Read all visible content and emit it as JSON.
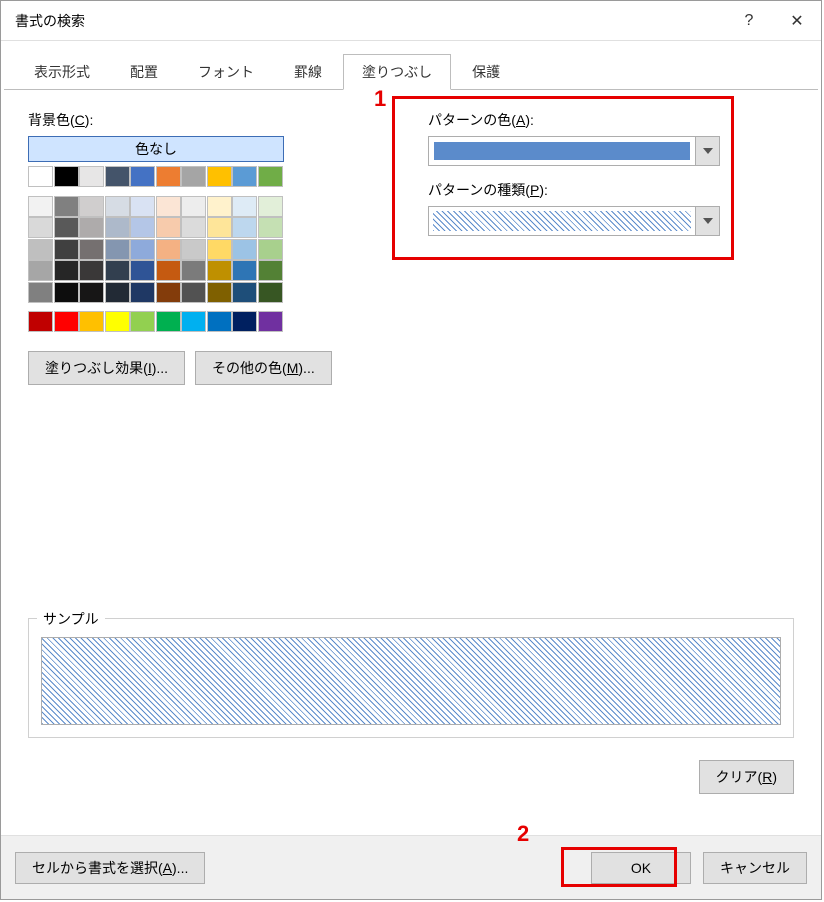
{
  "window": {
    "title": "書式の検索",
    "help_symbol": "?",
    "close_symbol": "✕"
  },
  "tabs": [
    {
      "label": "表示形式",
      "active": false
    },
    {
      "label": "配置",
      "active": false
    },
    {
      "label": "フォント",
      "active": false
    },
    {
      "label": "罫線",
      "active": false
    },
    {
      "label": "塗りつぶし",
      "active": true
    },
    {
      "label": "保護",
      "active": false
    }
  ],
  "fill_tab": {
    "bgcolor_label_pre": "背景色(",
    "bgcolor_label_u": "C",
    "bgcolor_label_post": "):",
    "no_color_label": "色なし",
    "effects_btn_pre": "塗りつぶし効果(",
    "effects_btn_u": "I",
    "effects_btn_post": ")...",
    "more_colors_btn_pre": "その他の色(",
    "more_colors_btn_u": "M",
    "more_colors_btn_post": ")...",
    "pattern_color_label_pre": "パターンの色(",
    "pattern_color_label_u": "A",
    "pattern_color_label_post": "):",
    "pattern_type_label_pre": "パターンの種類(",
    "pattern_type_label_u": "P",
    "pattern_type_label_post": "):",
    "selected_pattern_color": "#5b8bcb",
    "selected_pattern_type": "diagonal-hatch",
    "sample_label": "サンプル",
    "clear_btn_pre": "クリア(",
    "clear_btn_u": "R",
    "clear_btn_post": ")"
  },
  "color_palette": {
    "row_top": [
      "#ffffff",
      "#000000",
      "#e7e6e6",
      "#44546a",
      "#4472c4",
      "#ed7d31",
      "#a5a5a5",
      "#ffc000",
      "#5b9bd5",
      "#70ad47"
    ],
    "rows_theme": [
      [
        "#f2f2f2",
        "#808080",
        "#d0cece",
        "#d6dce4",
        "#d9e2f3",
        "#fbe5d5",
        "#ededed",
        "#fff2cc",
        "#deebf6",
        "#e2efd9"
      ],
      [
        "#d9d9d9",
        "#595959",
        "#aeabab",
        "#adb9ca",
        "#b4c6e7",
        "#f7cbac",
        "#dbdbdb",
        "#fee599",
        "#bdd7ee",
        "#c5e0b3"
      ],
      [
        "#bfbfbf",
        "#404040",
        "#757070",
        "#8496b0",
        "#8eaadb",
        "#f4b183",
        "#c9c9c9",
        "#ffd965",
        "#9cc3e5",
        "#a8d08d"
      ],
      [
        "#a6a6a6",
        "#262626",
        "#3a3838",
        "#323f4f",
        "#2f5496",
        "#c55a11",
        "#7b7b7b",
        "#bf9000",
        "#2e75b5",
        "#538135"
      ],
      [
        "#808080",
        "#0d0d0d",
        "#171616",
        "#222a35",
        "#1f3864",
        "#833c0b",
        "#525252",
        "#7f6000",
        "#1e4e79",
        "#375623"
      ]
    ],
    "row_standard": [
      "#c00000",
      "#ff0000",
      "#ffc000",
      "#ffff00",
      "#92d050",
      "#00b050",
      "#00b0f0",
      "#0070c0",
      "#002060",
      "#7030a0"
    ]
  },
  "footer": {
    "from_cell_btn_pre": "セルから書式を選択(",
    "from_cell_btn_u": "A",
    "from_cell_btn_post": ")...",
    "ok_label": "OK",
    "cancel_label": "キャンセル"
  },
  "annotations": {
    "a1_label": "1",
    "a2_label": "2"
  }
}
